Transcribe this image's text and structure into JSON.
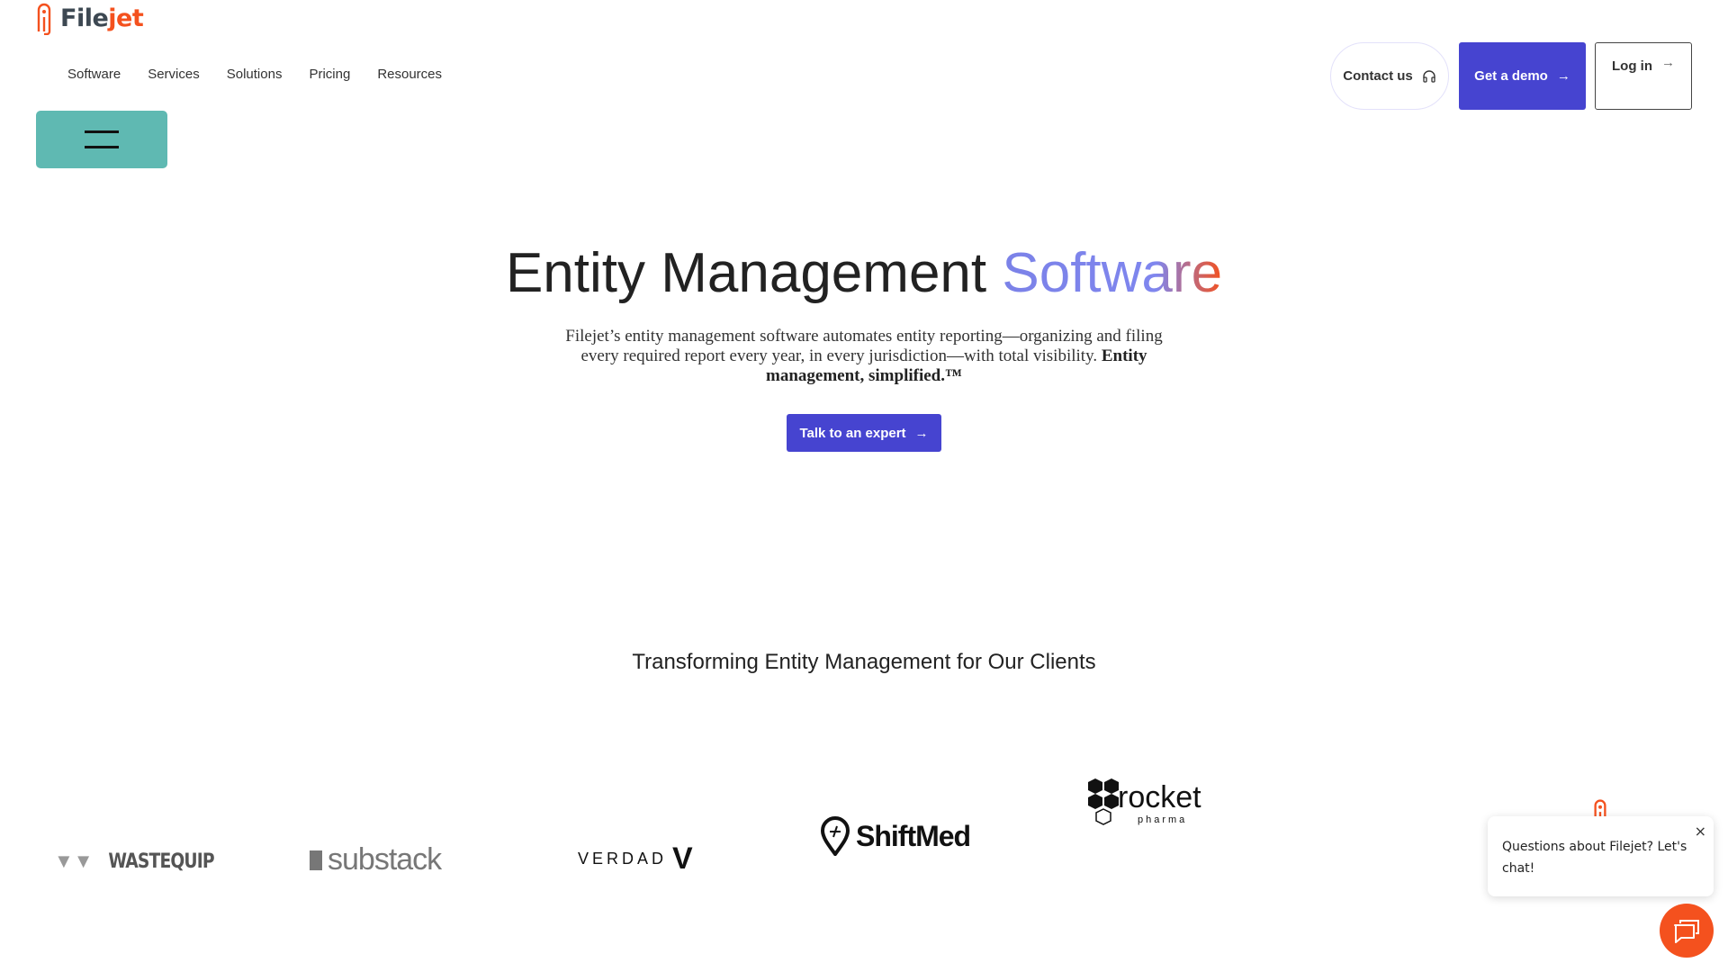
{
  "brand": {
    "name_part1": "File",
    "name_part2": "jet",
    "accent": "#f4511e"
  },
  "nav": {
    "items": [
      "Software",
      "Services",
      "Solutions",
      "Pricing",
      "Resources"
    ]
  },
  "header": {
    "contact_label": "Contact us",
    "demo_label": "Get a demo",
    "login_label": "Log in"
  },
  "hero": {
    "title_main": "Entity Management",
    "title_highlight": "Software",
    "lead_text": "Filejet’s entity management software automates entity reporting—organizing and filing every required report every year, in every jurisdiction—with total visibility.",
    "lead_bold": "Entity management, simplified.™",
    "cta_label": "Talk to an expert"
  },
  "clients": {
    "heading": "Transforming Entity Management for Our Clients",
    "logos": [
      "WASTEQUIP",
      "substack",
      "VERDAD",
      "ShiftMed",
      "rocket",
      "pharma"
    ]
  },
  "chat": {
    "message": "Questions about Filejet? Let's chat!",
    "close": "×"
  },
  "colors": {
    "primary": "#4644d0",
    "teal": "#5fb9b2",
    "orange": "#f4511e"
  }
}
